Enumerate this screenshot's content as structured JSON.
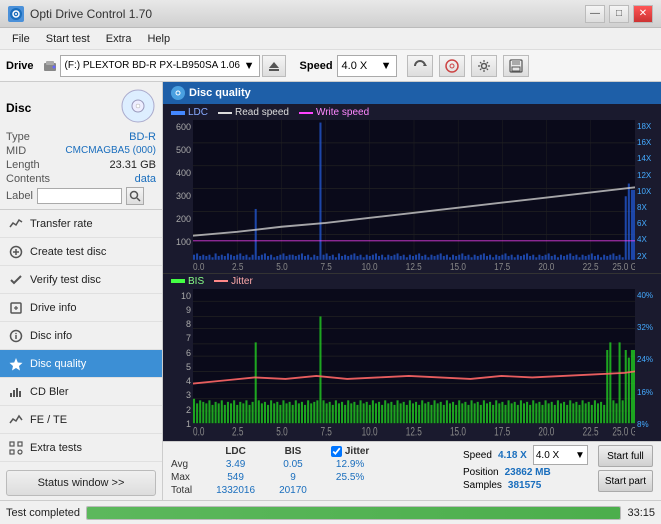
{
  "window": {
    "title": "Opti Drive Control 1.70",
    "icon": "O"
  },
  "titlebar": {
    "minimize": "—",
    "maximize": "□",
    "close": "✕"
  },
  "menu": {
    "items": [
      "File",
      "Start test",
      "Extra",
      "Help"
    ]
  },
  "toolbar": {
    "drive_label": "Drive",
    "drive_value": "(F:)  PLEXTOR BD-R  PX-LB950SA 1.06",
    "speed_label": "Speed",
    "speed_value": "4.0 X"
  },
  "disc": {
    "label": "Disc",
    "type_key": "Type",
    "type_val": "BD-R",
    "mid_key": "MID",
    "mid_val": "CMCMAGBA5 (000)",
    "length_key": "Length",
    "length_val": "23.31 GB",
    "contents_key": "Contents",
    "contents_val": "data",
    "label_key": "Label",
    "label_placeholder": ""
  },
  "nav": {
    "items": [
      {
        "id": "transfer-rate",
        "label": "Transfer rate",
        "icon": "📈"
      },
      {
        "id": "create-test-disc",
        "label": "Create test disc",
        "icon": "💿"
      },
      {
        "id": "verify-test-disc",
        "label": "Verify test disc",
        "icon": "✔"
      },
      {
        "id": "drive-info",
        "label": "Drive info",
        "icon": "ℹ"
      },
      {
        "id": "disc-info",
        "label": "Disc info",
        "icon": "📋"
      },
      {
        "id": "disc-quality",
        "label": "Disc quality",
        "icon": "★",
        "active": true
      },
      {
        "id": "cd-bler",
        "label": "CD Bler",
        "icon": "📊"
      },
      {
        "id": "fe-te",
        "label": "FE / TE",
        "icon": "📉"
      },
      {
        "id": "extra-tests",
        "label": "Extra tests",
        "icon": "🔬"
      }
    ],
    "status_button": "Status window >>"
  },
  "disc_quality": {
    "title": "Disc quality",
    "legend": {
      "ldc": "LDC",
      "read_speed": "Read speed",
      "write_speed": "Write speed"
    },
    "legend2": {
      "bis": "BIS",
      "jitter": "Jitter"
    },
    "upper_y_max": 600,
    "upper_y_labels": [
      "600",
      "500",
      "400",
      "300",
      "200",
      "100"
    ],
    "upper_y2_labels": [
      "18X",
      "16X",
      "14X",
      "12X",
      "10X",
      "8X",
      "6X",
      "4X",
      "2X"
    ],
    "x_labels": [
      "0.0",
      "2.5",
      "5.0",
      "7.5",
      "10.0",
      "12.5",
      "15.0",
      "17.5",
      "20.0",
      "22.5",
      "25.0 GB"
    ],
    "lower_y_labels": [
      "10",
      "9",
      "8",
      "7",
      "6",
      "5",
      "4",
      "3",
      "2",
      "1"
    ],
    "lower_y2_labels": [
      "40%",
      "32%",
      "24%",
      "16%",
      "8%"
    ]
  },
  "stats": {
    "col_ldc": "LDC",
    "col_bis": "BIS",
    "col_jitter": "Jitter",
    "col_speed": "Speed",
    "row_avg": "Avg",
    "row_max": "Max",
    "row_total": "Total",
    "ldc_avg": "3.49",
    "ldc_max": "549",
    "ldc_total": "1332016",
    "bis_avg": "0.05",
    "bis_max": "9",
    "bis_total": "20170",
    "jitter_avg": "12.9%",
    "jitter_max": "25.5%",
    "jitter_checked": true,
    "speed_label": "Speed",
    "speed_val": "4.18 X",
    "speed_select": "4.0 X",
    "position_label": "Position",
    "position_val": "23862 MB",
    "samples_label": "Samples",
    "samples_val": "381575",
    "btn_start_full": "Start full",
    "btn_start_part": "Start part"
  },
  "statusbar": {
    "text": "Test completed",
    "progress": 100,
    "time": "33:15"
  }
}
